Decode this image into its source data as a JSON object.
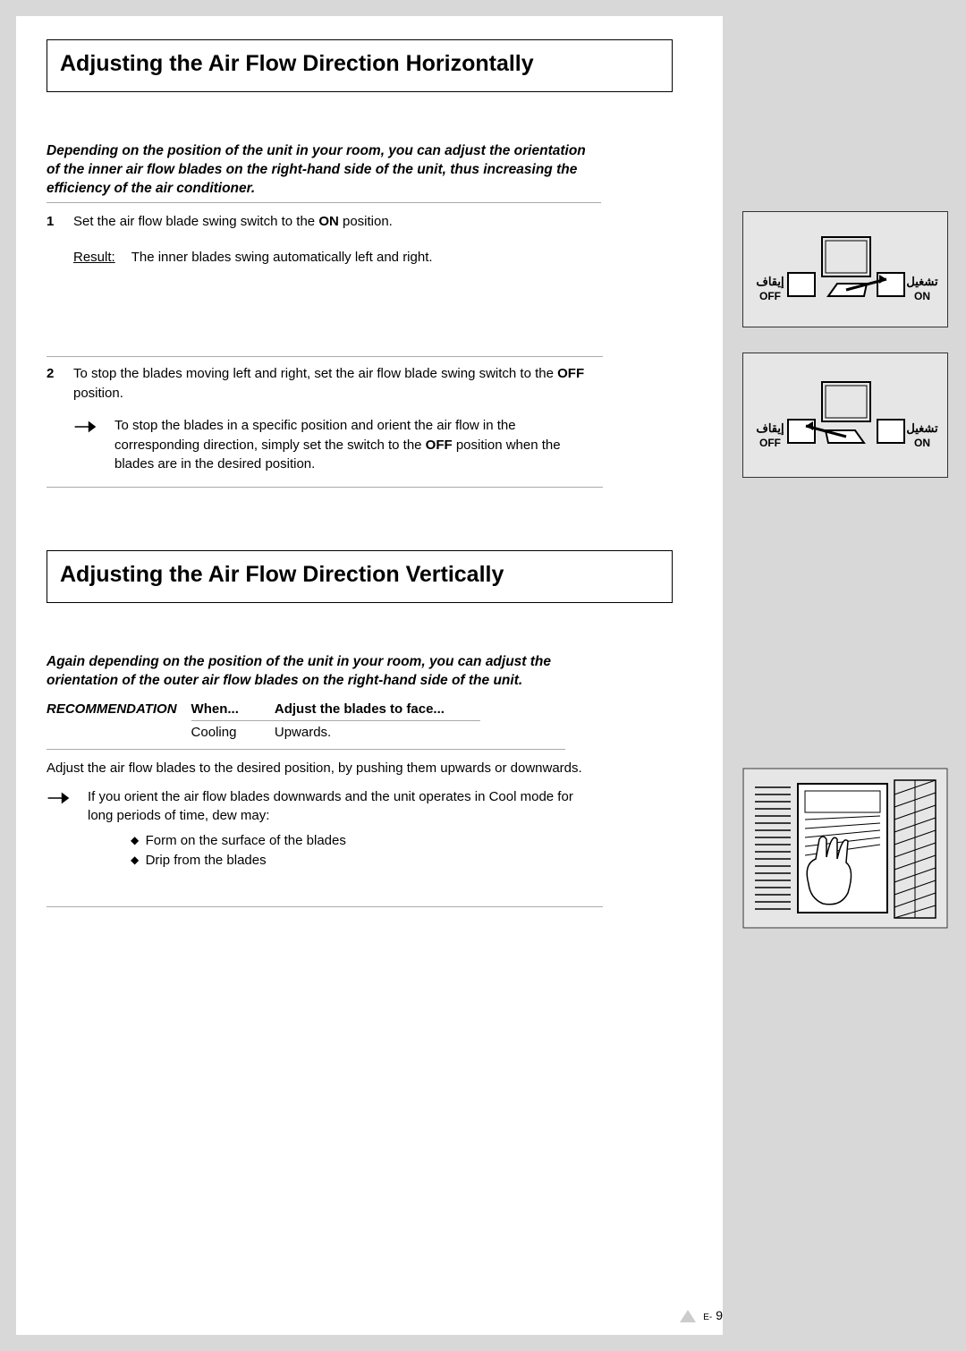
{
  "section1": {
    "title": "Adjusting the Air Flow Direction Horizontally",
    "intro": "Depending on the position of the unit in your room, you can adjust the orientation of the inner air flow blades on the right-hand side of the unit, thus increasing the efficiency of the air conditioner.",
    "step1_num": "1",
    "step1_a": "Set the air flow blade swing switch to the ",
    "step1_b": "ON",
    "step1_c": " position.",
    "result_label": "Result:",
    "result_text": "The inner blades swing automatically left and right.",
    "step2_num": "2",
    "step2_a": "To stop the blades moving left and right, set the air flow blade swing switch to the ",
    "step2_b": "OFF",
    "step2_c": " position.",
    "note_a": "To stop the blades in a specific position and orient the air flow in the corresponding direction, simply set the switch to the ",
    "note_b": "OFF",
    "note_c": " position when the blades are in the desired position."
  },
  "section2": {
    "title": "Adjusting the Air Flow Direction Vertically",
    "intro": "Again depending on the position of the unit in your room, you can adjust the orientation of the outer air flow blades on the right-hand side of the unit.",
    "rec_label": "RECOMMENDATION",
    "rec_h1": "When...",
    "rec_h2": "Adjust the blades to face...",
    "rec_r1c1": "Cooling",
    "rec_r1c2": "Upwards.",
    "plain": "Adjust the air flow blades to the desired position, by pushing them upwards or downwards.",
    "note": "If you orient the air flow blades downwards and the unit operates in Cool mode for long periods of time, dew may:",
    "bul1": "Form on the surface of the blades",
    "bul2": "Drip from the blades"
  },
  "figures": {
    "off_label": "OFF",
    "on_label": "ON",
    "ar_off": "إيقاف",
    "ar_on": "تشغيل"
  },
  "footer": {
    "page_prefix": "E-",
    "page_num": "9"
  }
}
